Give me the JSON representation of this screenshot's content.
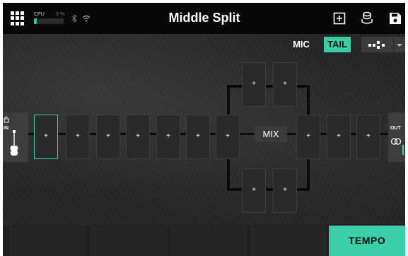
{
  "header": {
    "menu_icon": "grid-menu-icon",
    "cpu_label": "CPU",
    "cpu_percent": "9 %",
    "cpu_load": 0.09,
    "bluetooth_icon": "bluetooth-icon",
    "wifi_icon": "wifi-icon",
    "preset_name": "Middle Split",
    "add_icon": "add-box-icon",
    "stack_icon": "preset-stack-icon",
    "save_icon": "save-icon"
  },
  "toolbar": {
    "mic_label": "MIC",
    "tail_label": "TAIL",
    "tail_active": true,
    "layout_icon": "layout-dots-icon",
    "dropdown_icon": "chevron-down-icon"
  },
  "signal_chain": {
    "input_label": "IN",
    "output_label": "OUT",
    "mix_label": "MIX",
    "empty_slot_label": "+",
    "input_lock_icon": "lock-icon",
    "input_source_icon": "guitar-icon",
    "output_icon": "stereo-rings-icon"
  },
  "footer": {
    "footswitches": [
      "",
      "",
      "",
      ""
    ],
    "tempo_label": "TEMPO"
  },
  "colors": {
    "accent": "#39d0a8",
    "background": "#1f1f1f",
    "topbar": "#080808",
    "slot": "#2a2a2a"
  }
}
